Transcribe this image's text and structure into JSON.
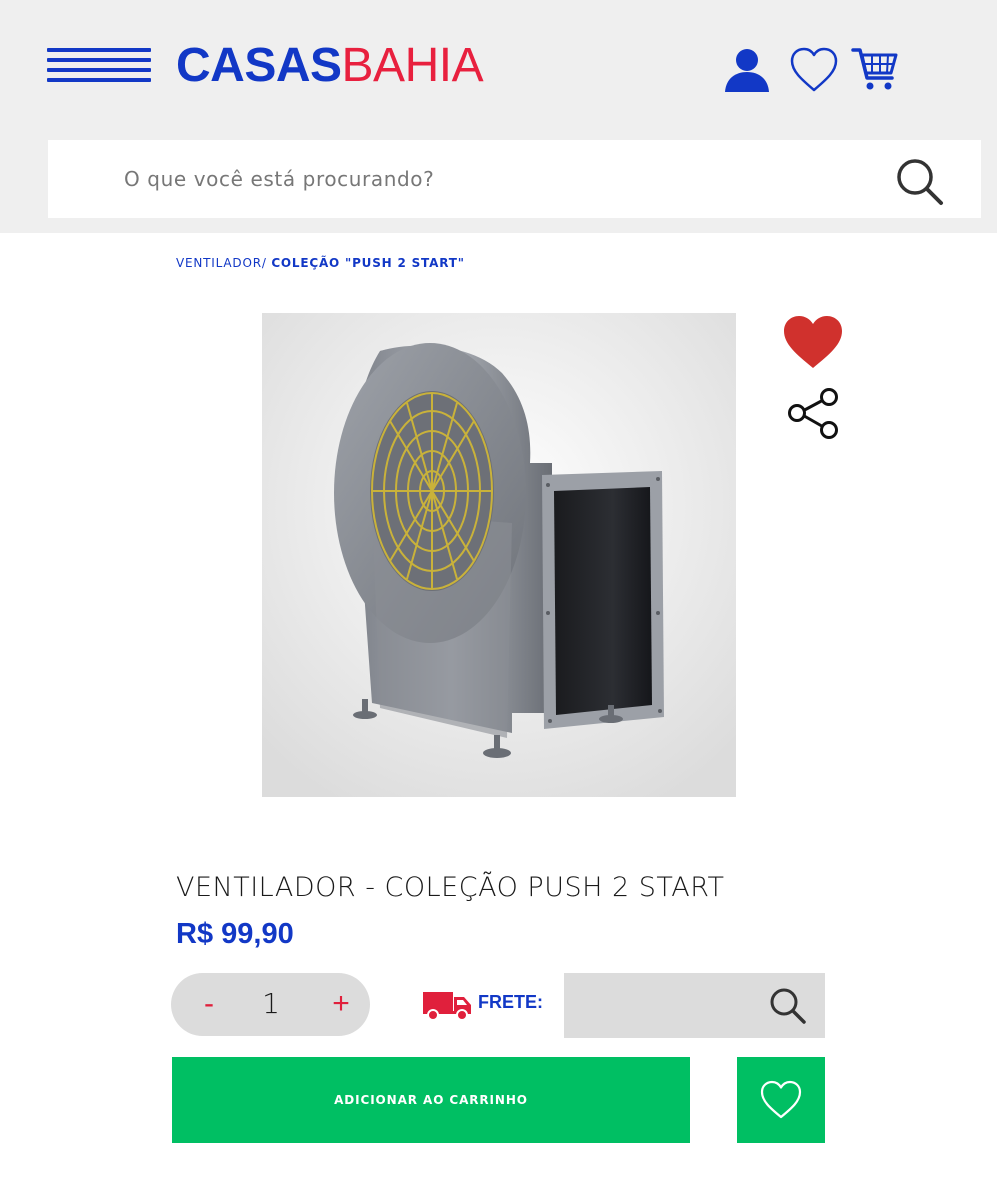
{
  "brand": {
    "part1": "CASAS",
    "part2": "BAHIA",
    "color_primary": "#1238c6",
    "color_secondary": "#e8203e"
  },
  "header": {
    "icons": [
      "menu-icon",
      "user-icon",
      "heart-icon",
      "cart-icon"
    ]
  },
  "search": {
    "placeholder": "O que você está procurando?",
    "value": ""
  },
  "breadcrumb": {
    "category": "VENTILADOR/",
    "current": "COLEÇÃO \"PUSH 2 START\""
  },
  "product": {
    "title": "VENTILADOR - COLEÇÃO PUSH 2 START",
    "price": "R$ 99,90",
    "quantity": "1",
    "qty_minus": "-",
    "qty_plus": "+",
    "favorited": true
  },
  "shipping": {
    "label": "FRETE:",
    "value": ""
  },
  "actions": {
    "add_to_cart": "ADICIONAR AO CARRINHO"
  },
  "colors": {
    "accent_green": "#00bf63",
    "heart_red": "#d0312d",
    "qty_red": "#e0203c",
    "panel_gray": "#dcdcdc"
  }
}
